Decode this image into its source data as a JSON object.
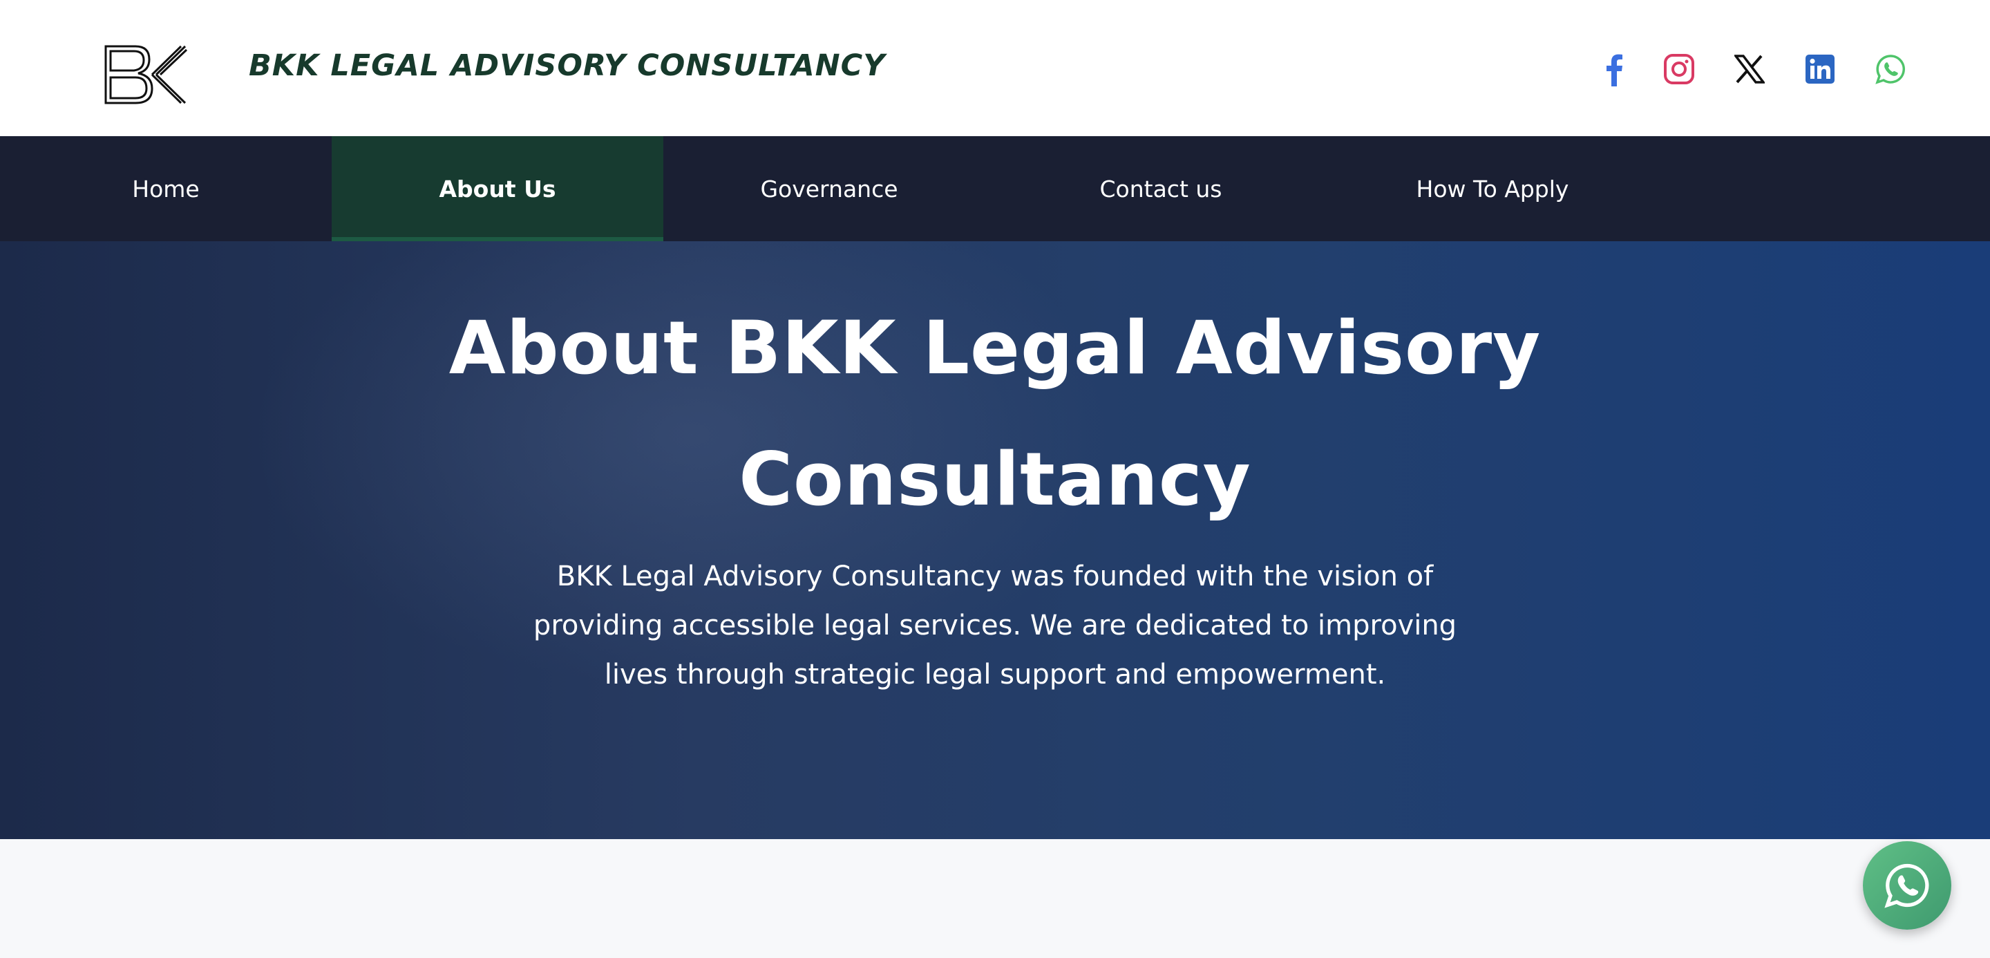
{
  "header": {
    "brand": "BKK LEGAL ADVISORY CONSULTANCY",
    "logo_icon": "bkk-logo",
    "social": [
      {
        "name": "facebook-icon",
        "color": "#3b6fe0"
      },
      {
        "name": "instagram-icon",
        "color": "#d93a63"
      },
      {
        "name": "x-icon",
        "color": "#111111"
      },
      {
        "name": "linkedin-icon",
        "color": "#2b66c2"
      },
      {
        "name": "whatsapp-icon",
        "color": "#4fc46a"
      }
    ]
  },
  "nav": {
    "items": [
      {
        "label": "Home",
        "active": false
      },
      {
        "label": "About Us",
        "active": true
      },
      {
        "label": "Governance",
        "active": false
      },
      {
        "label": "Contact us",
        "active": false
      },
      {
        "label": "How To Apply",
        "active": false
      }
    ]
  },
  "hero": {
    "title": "About BKK Legal Advisory Consultancy",
    "description": "BKK Legal Advisory Consultancy was founded with the vision of providing accessible legal services. We are dedicated to improving lives through strategic legal support and empowerment."
  },
  "floating_button": {
    "icon": "whatsapp-icon"
  },
  "colors": {
    "brand_text": "#173a2c",
    "nav_bg": "#1a1f33",
    "nav_active_bg": "#173b30",
    "hero_start": "#1c2a4a",
    "hero_end": "#1a3d78",
    "fab": "#4caf7a"
  }
}
